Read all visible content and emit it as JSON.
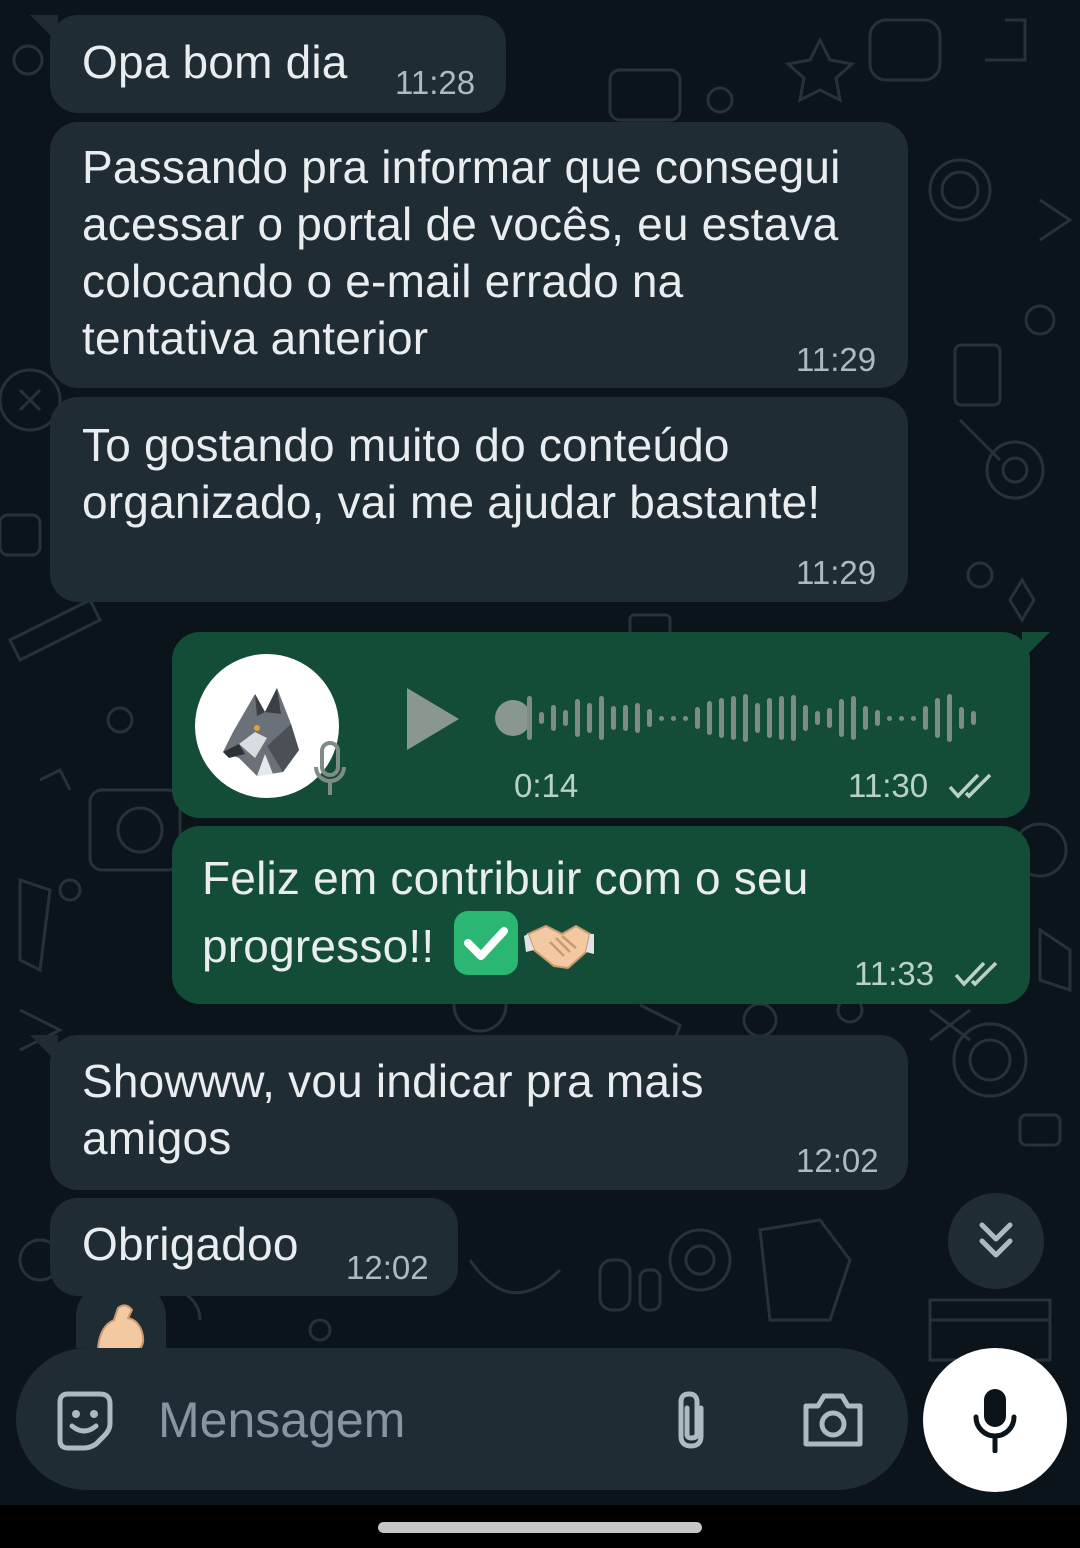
{
  "messages": [
    {
      "text": "Opa bom dia",
      "time": "11:28",
      "direction": "in"
    },
    {
      "text": "Passando pra informar que consegui\nacessar o portal de vocês, eu estava\ncolocando o e-mail errado na\ntentativa anterior",
      "time": "11:29",
      "direction": "in"
    },
    {
      "text": "To gostando muito do conteúdo\norganizado, vai me ajudar bastante!",
      "time": "11:29",
      "direction": "in"
    },
    {
      "type": "voice",
      "duration": "0:14",
      "time": "11:30",
      "direction": "out",
      "status": "read",
      "playback_progress": 0
    },
    {
      "text": "Feliz em contribuir com o seu\nprogresso!!",
      "emojis": [
        "✅",
        "🤝"
      ],
      "time": "11:33",
      "direction": "out",
      "status": "read"
    },
    {
      "text": "Showww, vou indicar pra mais\namigos",
      "time": "12:02",
      "direction": "in"
    },
    {
      "text": "Obrigadoo",
      "time": "12:02",
      "direction": "in",
      "reaction": "💪"
    }
  ],
  "composer": {
    "placeholder": "Mensagem"
  },
  "icons": {
    "sticker": "sticker-icon",
    "attach": "paperclip-icon",
    "camera": "camera-icon",
    "mic": "mic-icon",
    "play": "play-icon",
    "scroll_down": "double-chevron-down-icon",
    "read_status": "double-check-icon"
  },
  "colors": {
    "background": "#0b141a",
    "incoming_bubble": "#202c33",
    "outgoing_bubble": "#144d37",
    "text": "#e9edef",
    "meta": "#aebac1",
    "accent": "#ffffff"
  }
}
